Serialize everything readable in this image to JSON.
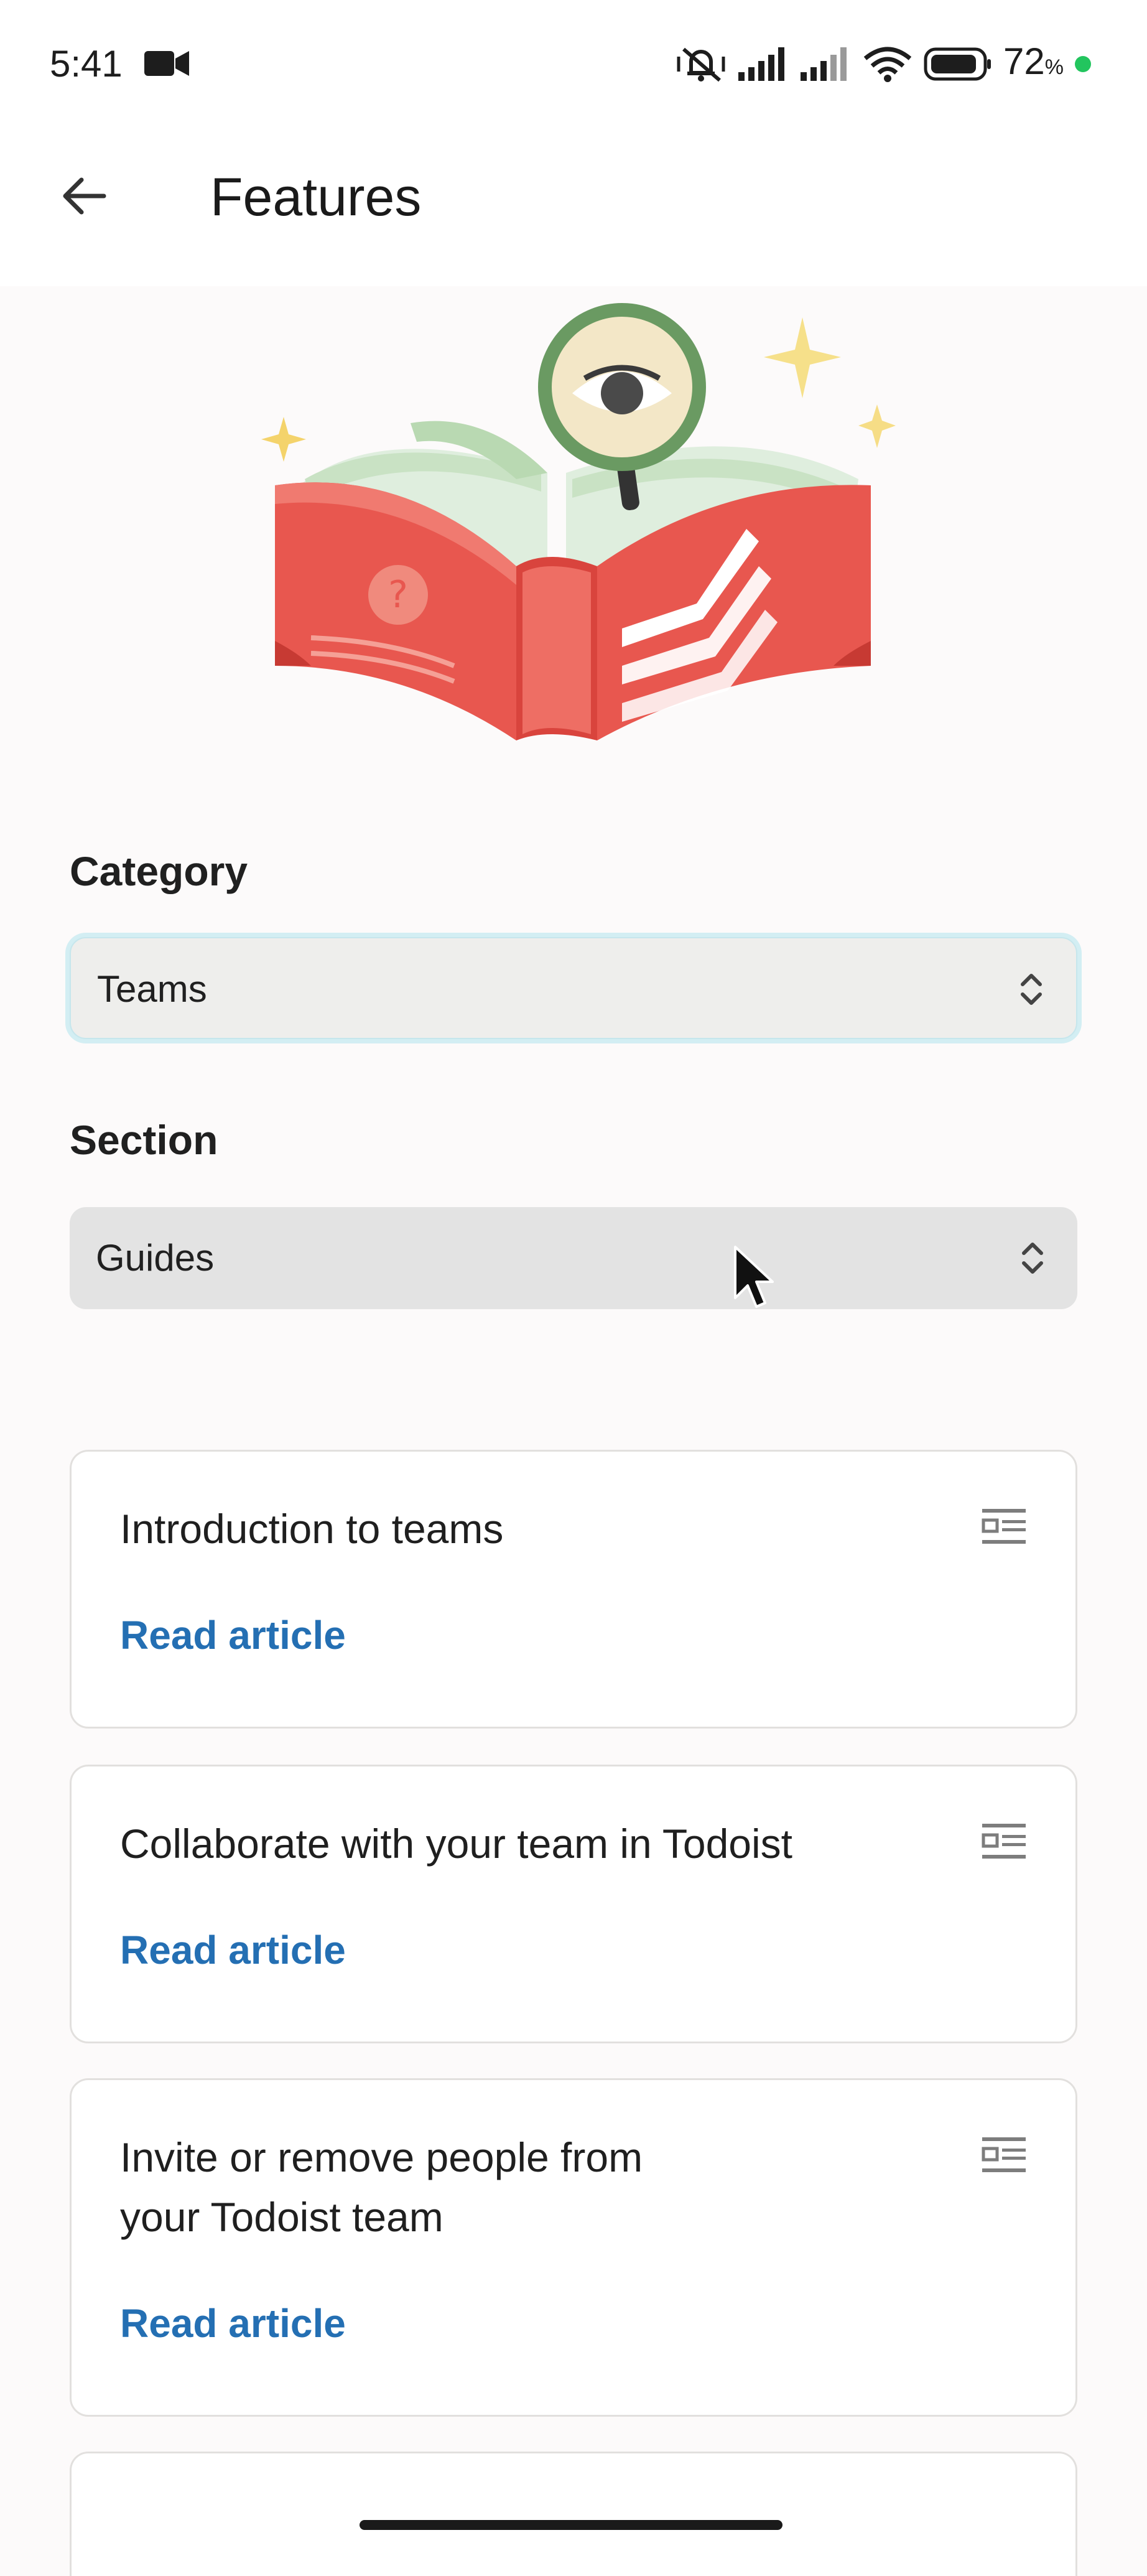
{
  "status_bar": {
    "time": "5:41",
    "battery_percent": "72",
    "battery_unit": "%",
    "icons": [
      "video-camera-icon",
      "mute-vibrate-icon",
      "signal-icon",
      "signal-icon",
      "wifi-icon",
      "battery-icon",
      "charging-dot-icon"
    ]
  },
  "app_bar": {
    "title": "Features",
    "back_icon": "arrow-left-icon"
  },
  "hero": {
    "icon": "open-book-magnifier-illustration"
  },
  "filters": {
    "category_label": "Category",
    "category_value": "Teams",
    "section_label": "Section",
    "section_value": "Guides"
  },
  "articles": [
    {
      "title": "Introduction to teams",
      "link": "Read article"
    },
    {
      "title": "Collaborate with your team in Todoist",
      "link": "Read article"
    },
    {
      "title": "Invite or remove people from your Todoist team",
      "link": "Read article"
    }
  ],
  "colors": {
    "link": "#246fb3",
    "background": "#fcfafa",
    "accent_red": "#e8574f",
    "focus_ring": "#d3eef3"
  }
}
